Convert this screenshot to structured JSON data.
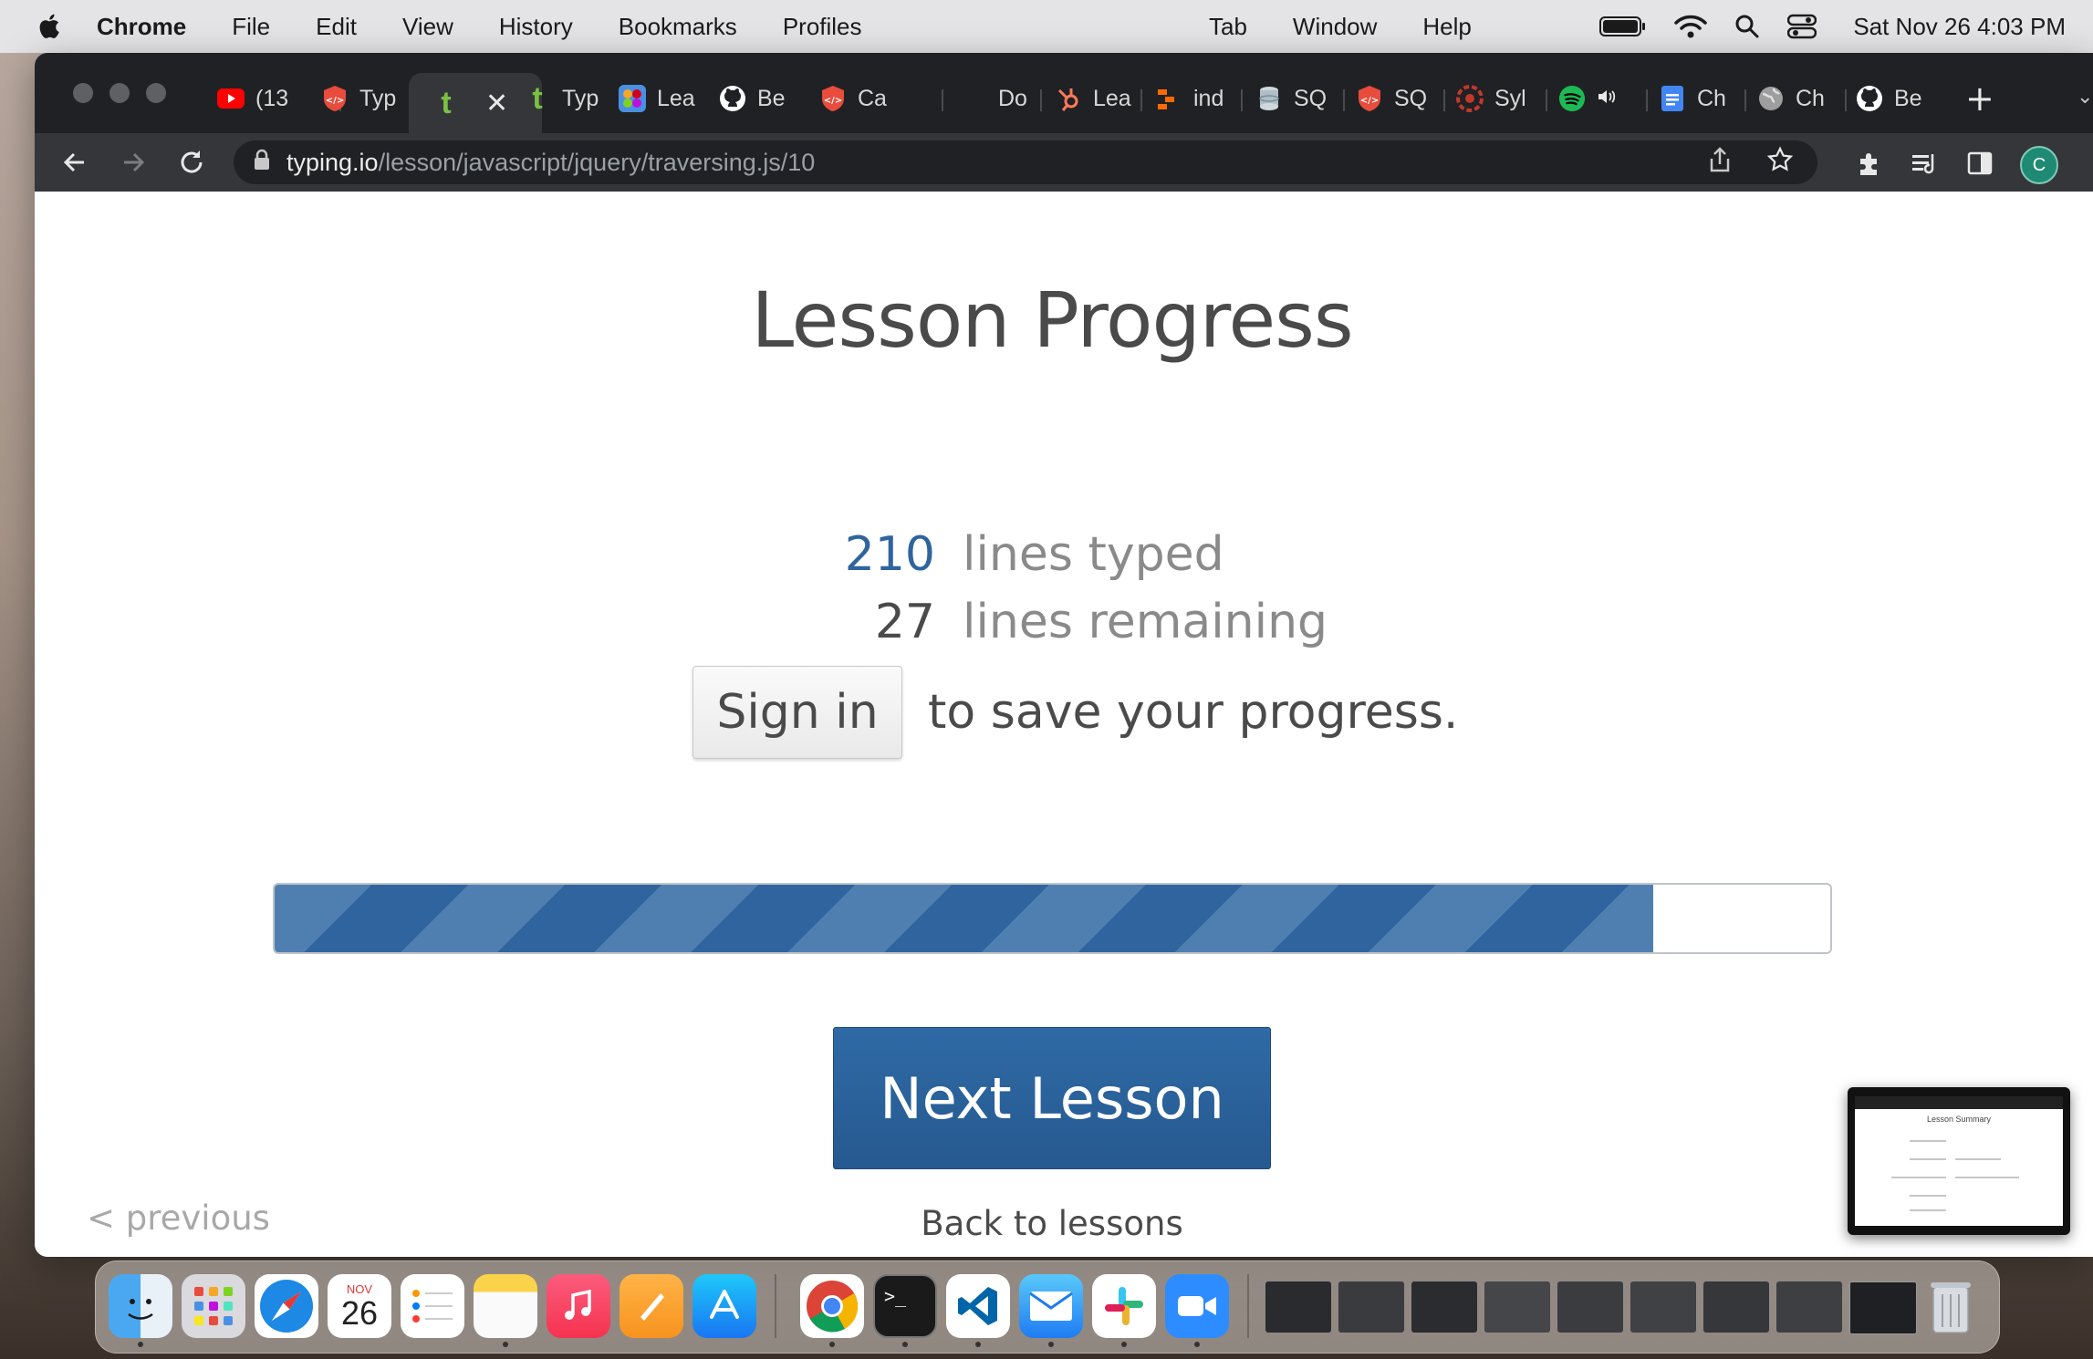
{
  "menubar": {
    "app_name": "Chrome",
    "items": [
      "File",
      "Edit",
      "View",
      "History",
      "Bookmarks",
      "Profiles"
    ],
    "right_items": [
      "Tab",
      "Window",
      "Help"
    ],
    "clock": "Sat Nov 26  4:03 PM",
    "icons": [
      "apple-icon",
      "battery-icon",
      "wifi-icon",
      "spotlight-search-icon",
      "control-center-icon"
    ]
  },
  "tabs": [
    {
      "label": "(13",
      "icon": "youtube-icon",
      "color": "#ff0000"
    },
    {
      "label": "Typ",
      "icon": "codecademy-shield-icon",
      "color": "#e74c3c"
    },
    {
      "label": "t",
      "icon": "typing-io-icon",
      "color": "#7bc043",
      "active": true
    },
    {
      "label": "Typ",
      "icon": "typing-io-icon",
      "color": "#7bc043"
    },
    {
      "label": "Lea",
      "icon": "colorful-app-icon",
      "color": "#4a90e2"
    },
    {
      "label": "Be",
      "icon": "github-icon",
      "color": "#ffffff"
    },
    {
      "label": "Ca",
      "icon": "codecademy-shield-icon",
      "color": "#e74c3c"
    },
    {
      "label": "Do",
      "icon": "blank-icon",
      "color": "#202124"
    },
    {
      "label": "Lea",
      "icon": "hubspot-icon",
      "color": "#ff7a59"
    },
    {
      "label": "ind",
      "icon": "indeed-chart-icon",
      "color": "#ff6a00"
    },
    {
      "label": "SQ",
      "icon": "database-icon",
      "color": "#cfd8dc"
    },
    {
      "label": "SQ",
      "icon": "codecademy-shield-icon",
      "color": "#e74c3c"
    },
    {
      "label": "Syl",
      "icon": "aperture-icon",
      "color": "#c0392b"
    },
    {
      "label": "",
      "icon": "spotify-icon",
      "color": "#1db954",
      "audio": true
    },
    {
      "label": "Ch",
      "icon": "google-docs-icon",
      "color": "#4285f4"
    },
    {
      "label": "Ch",
      "icon": "globe-icon",
      "color": "#bdbdbd"
    },
    {
      "label": "Be",
      "icon": "github-icon",
      "color": "#ffffff"
    }
  ],
  "toolbar": {
    "url_host": "typing.io",
    "url_path": "/lesson/javascript/jquery/traversing.js/10",
    "profile_initial": "C"
  },
  "lesson": {
    "title": "Lesson Progress",
    "lines_typed": "210",
    "lines_typed_label": "lines typed",
    "lines_remaining": "27",
    "lines_remaining_label": "lines remaining",
    "sign_in_label": "Sign in",
    "save_text": "to save your progress.",
    "progress_fraction": 0.886,
    "next_label": "Next Lesson",
    "back_label": "Back to lessons",
    "previous_label": "< previous"
  },
  "thumbnail": {
    "title": "Lesson Summary"
  },
  "dock": {
    "calendar_month": "NOV",
    "calendar_day": "26",
    "apps": [
      "finder-icon",
      "launchpad-icon",
      "safari-icon",
      "calendar-icon",
      "reminders-icon",
      "notes-icon",
      "music-icon",
      "pages-icon",
      "app-store-icon",
      "chrome-icon",
      "terminal-icon",
      "vscode-icon",
      "mail-icon",
      "slack-icon",
      "zoom-icon"
    ]
  },
  "colors": {
    "accent_blue": "#2f649f",
    "typed_number_blue": "#2f649f",
    "chrome_dark": "#202124"
  }
}
